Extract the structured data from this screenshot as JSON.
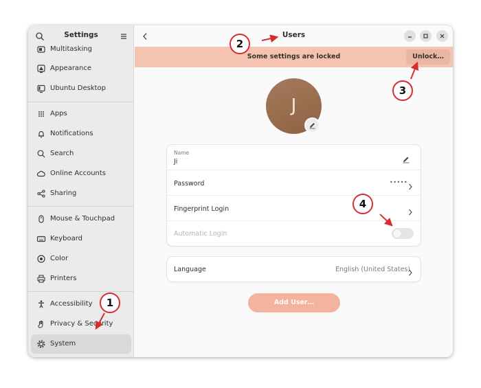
{
  "sidebar": {
    "title": "Settings",
    "items": [
      {
        "label": "Multitasking",
        "icon": "multitasking-icon"
      },
      {
        "label": "Appearance",
        "icon": "appearance-icon"
      },
      {
        "label": "Ubuntu Desktop",
        "icon": "ubuntu-desktop-icon"
      },
      {
        "label": "Apps",
        "icon": "apps-grid-icon"
      },
      {
        "label": "Notifications",
        "icon": "bell-icon"
      },
      {
        "label": "Search",
        "icon": "search-icon"
      },
      {
        "label": "Online Accounts",
        "icon": "cloud-icon"
      },
      {
        "label": "Sharing",
        "icon": "share-icon"
      },
      {
        "label": "Mouse & Touchpad",
        "icon": "mouse-icon"
      },
      {
        "label": "Keyboard",
        "icon": "keyboard-icon"
      },
      {
        "label": "Color",
        "icon": "color-icon"
      },
      {
        "label": "Printers",
        "icon": "printer-icon"
      },
      {
        "label": "Accessibility",
        "icon": "accessibility-icon"
      },
      {
        "label": "Privacy & Security",
        "icon": "hand-icon"
      },
      {
        "label": "System",
        "icon": "gear-icon"
      }
    ],
    "active": "System"
  },
  "header": {
    "title": "Users"
  },
  "lock_banner": {
    "text": "Some settings are locked",
    "unlock_label": "Unlock…"
  },
  "avatar": {
    "initial": "J"
  },
  "account": {
    "name_label": "Name",
    "name_value": "Ji",
    "password_label": "Password",
    "password_value": "•••••",
    "fingerprint_label": "Fingerprint Login",
    "autologin_label": "Automatic Login",
    "autologin_enabled": false
  },
  "language": {
    "label": "Language",
    "value": "English (United States)"
  },
  "add_user_label": "Add User…",
  "annotations": {
    "one": "1",
    "two": "2",
    "three": "3",
    "four": "4"
  },
  "colors": {
    "accent": "#f4b39f",
    "lock_banner": "#f5c4b1",
    "annotation": "#d42e2e"
  }
}
